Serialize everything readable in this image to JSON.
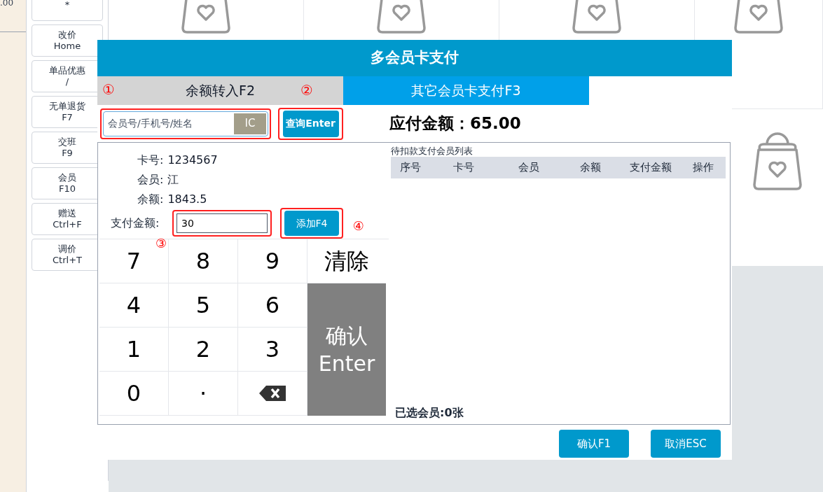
{
  "background": {
    "total": ".00",
    "sidebar_buttons": [
      {
        "key": "*"
      },
      {
        "label": "改价",
        "key": "Home"
      },
      {
        "label": "单品优惠",
        "key": "/"
      },
      {
        "label": "无单退货",
        "key": "F7"
      },
      {
        "label": "交班",
        "key": "F9"
      },
      {
        "label": "会员",
        "key": "F10"
      },
      {
        "label": "赠送",
        "key": "Ctrl+F"
      },
      {
        "label": "调价",
        "key": "Ctrl+T"
      }
    ]
  },
  "dialog": {
    "title": "多会员卡支付",
    "tabs": [
      {
        "label": "余额转入F2",
        "selected": true
      },
      {
        "label": "其它会员卡支付F3",
        "selected": false
      }
    ],
    "search": {
      "placeholder": "会员号/手机号/姓名",
      "ic_button": "IC",
      "query_button": "查询Enter"
    },
    "amount_due": "应付金额：65.00",
    "member_info": [
      {
        "label": "卡号:",
        "value": "1234567"
      },
      {
        "label": "会员:",
        "value": "江"
      },
      {
        "label": "余额:",
        "value": "1843.5"
      }
    ],
    "pay_amount": {
      "label": "支付金额:",
      "value": "30",
      "add_button": "添加F4"
    },
    "keypad": {
      "digit_keys": [
        {
          "kind": "key",
          "label": "7"
        },
        {
          "kind": "key",
          "label": "8"
        },
        {
          "kind": "key",
          "label": "9"
        },
        {
          "kind": "key",
          "label": "4"
        },
        {
          "kind": "key",
          "label": "5"
        },
        {
          "kind": "key",
          "label": "6"
        },
        {
          "kind": "key",
          "label": "1"
        },
        {
          "kind": "key",
          "label": "2"
        },
        {
          "kind": "key",
          "label": "3"
        },
        {
          "kind": "key",
          "label": "0"
        },
        {
          "kind": "key",
          "label": "·"
        },
        {
          "kind": "backspace"
        }
      ],
      "side_keys": [
        {
          "kind": "clear",
          "label": "清除"
        },
        {
          "kind": "confirm",
          "label": "确认",
          "sublabel": "Enter"
        }
      ]
    },
    "list": {
      "title": "待扣款支付会员列表",
      "columns": [
        "序号",
        "卡号",
        "会员",
        "余额",
        "支付金额",
        "操作"
      ],
      "footer": "已选会员:0张"
    },
    "buttons": [
      "确认F1",
      "取消ESC"
    ]
  },
  "annotations": [
    "①",
    "②",
    "③",
    "④"
  ]
}
